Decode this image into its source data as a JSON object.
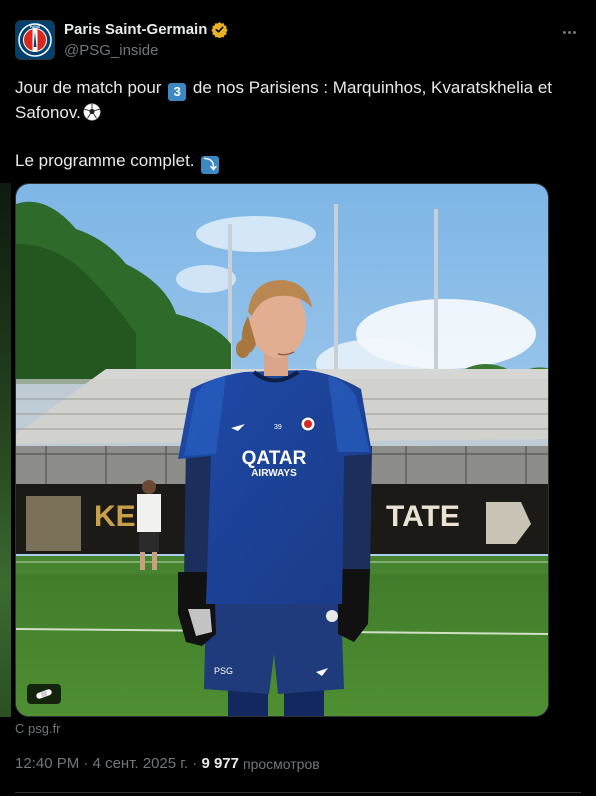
{
  "author": {
    "display_name": "Paris Saint-Germain",
    "handle": "@PSG_inside",
    "verified_color": "#e8b226",
    "avatar_text": "PARIS"
  },
  "tweet": {
    "line1_before": "Jour de match pour ",
    "line1_number": "3",
    "line1_after": " de nos Parisiens : Marquinhos, Kvaratskhelia et Safonov.",
    "line2": "Le programme complet.",
    "line2_arrow": "⤵"
  },
  "media": {
    "jersey_sponsor_line1": "QATAR",
    "jersey_sponsor_line2": "AIRWAYS",
    "banner_left_text": "KEN",
    "banner_right_text": "TATE",
    "alt_icon": "bandage-icon"
  },
  "source_label": "С psg.fr",
  "meta": {
    "time": "12:40 PM",
    "separator1": " · ",
    "date": "4 сент. 2025 г.",
    "separator2": " · ",
    "views_count": "9 977",
    "views_label": "просмотров"
  },
  "colors": {
    "background": "#000000",
    "text_primary": "#e7e9ea",
    "text_secondary": "#71767b",
    "keycap_blue": "#3b88c3",
    "psg_navy": "#004170"
  }
}
